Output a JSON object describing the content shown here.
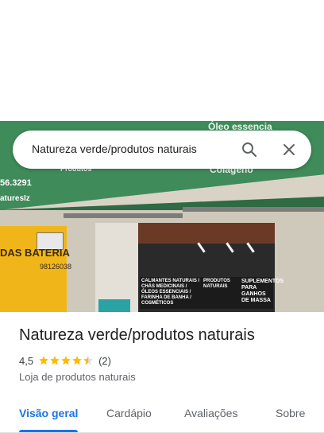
{
  "search": {
    "query": "Natureza verde/produtos naturais",
    "search_icon": "search-icon",
    "close_icon": "close-icon"
  },
  "photo": {
    "awning_lines": [
      "Óleo essencia",
      "56.3291",
      "aturesIz",
      "Colágeno",
      "Produtos"
    ],
    "yellow_sign": "DAS BATERIA",
    "yellow_phone": "98126038",
    "store_banner_left": "CALMANTES NATURAIS / CHÁS MEDICINAIS / ÓLEOS ESSENCIAIS / FARINHA DE BANHA / COSMÉTICOS",
    "store_banner_mid": "PRODUTOS NATURAIS",
    "store_banner_right": "SUPLEMENTOS PARA GANHOS DE MASSA"
  },
  "place": {
    "title": "Natureza verde/produtos naturais",
    "rating": "4,5",
    "stars_filled": 4.5,
    "review_count": "(2)",
    "category": "Loja de produtos naturais"
  },
  "tabs": [
    {
      "label": "Visão geral",
      "active": true
    },
    {
      "label": "Cardápio",
      "active": false
    },
    {
      "label": "Avaliações",
      "active": false
    },
    {
      "label": "Sobre",
      "active": false
    }
  ],
  "colors": {
    "accent": "#1a73e8",
    "star": "#fbbc04",
    "awning": "#3f8b5a"
  }
}
